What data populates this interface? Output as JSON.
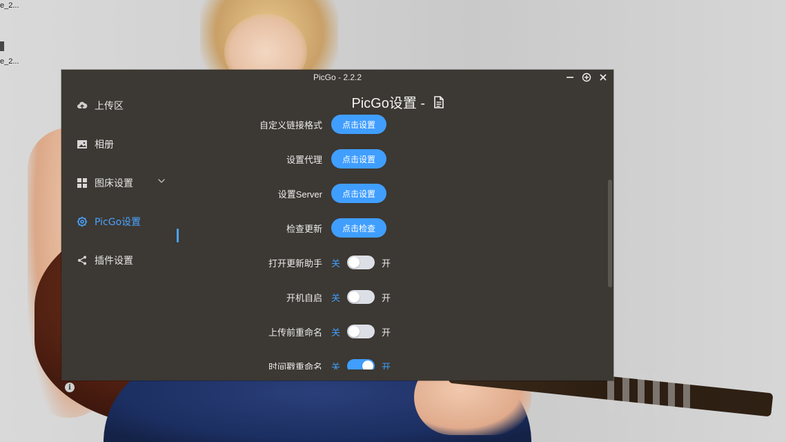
{
  "desktop": {
    "icon_texts": [
      "e_2...",
      "e_2..."
    ]
  },
  "window": {
    "title": "PicGo - 2.2.2",
    "controls": {
      "minimize": "minimize-icon",
      "maximize": "plus-circle-icon",
      "close": "close-icon"
    }
  },
  "sidebar": {
    "items": [
      {
        "label": "上传区",
        "icon": "upload-cloud-icon"
      },
      {
        "label": "相册",
        "icon": "image-icon"
      },
      {
        "label": "图床设置",
        "icon": "grid-icon",
        "has_chevron": true
      },
      {
        "label": "PicGo设置",
        "icon": "gear-icon",
        "active": true
      },
      {
        "label": "插件设置",
        "icon": "share-icon"
      }
    ],
    "footer_icon": "info-icon"
  },
  "content": {
    "title": "PicGo设置 -",
    "title_icon": "document-icon",
    "settings": [
      {
        "label": "自定义链接格式",
        "type": "button",
        "button_label": "点击设置"
      },
      {
        "label": "设置代理",
        "type": "button",
        "button_label": "点击设置"
      },
      {
        "label": "设置Server",
        "type": "button",
        "button_label": "点击设置"
      },
      {
        "label": "检查更新",
        "type": "button",
        "button_label": "点击检查"
      },
      {
        "label": "打开更新助手",
        "type": "switch",
        "off_label": "关",
        "on_label": "开",
        "value": false
      },
      {
        "label": "开机自启",
        "type": "switch",
        "off_label": "关",
        "on_label": "开",
        "value": false
      },
      {
        "label": "上传前重命名",
        "type": "switch",
        "off_label": "关",
        "on_label": "开",
        "value": false
      },
      {
        "label": "时间戳重命名",
        "type": "switch",
        "off_label": "关",
        "on_label": "开",
        "value": true
      }
    ]
  },
  "colors": {
    "window_bg": "#3c3833",
    "accent": "#409eff",
    "active_nav": "#4aa3ff",
    "switch_off": "#dcdfe6"
  }
}
